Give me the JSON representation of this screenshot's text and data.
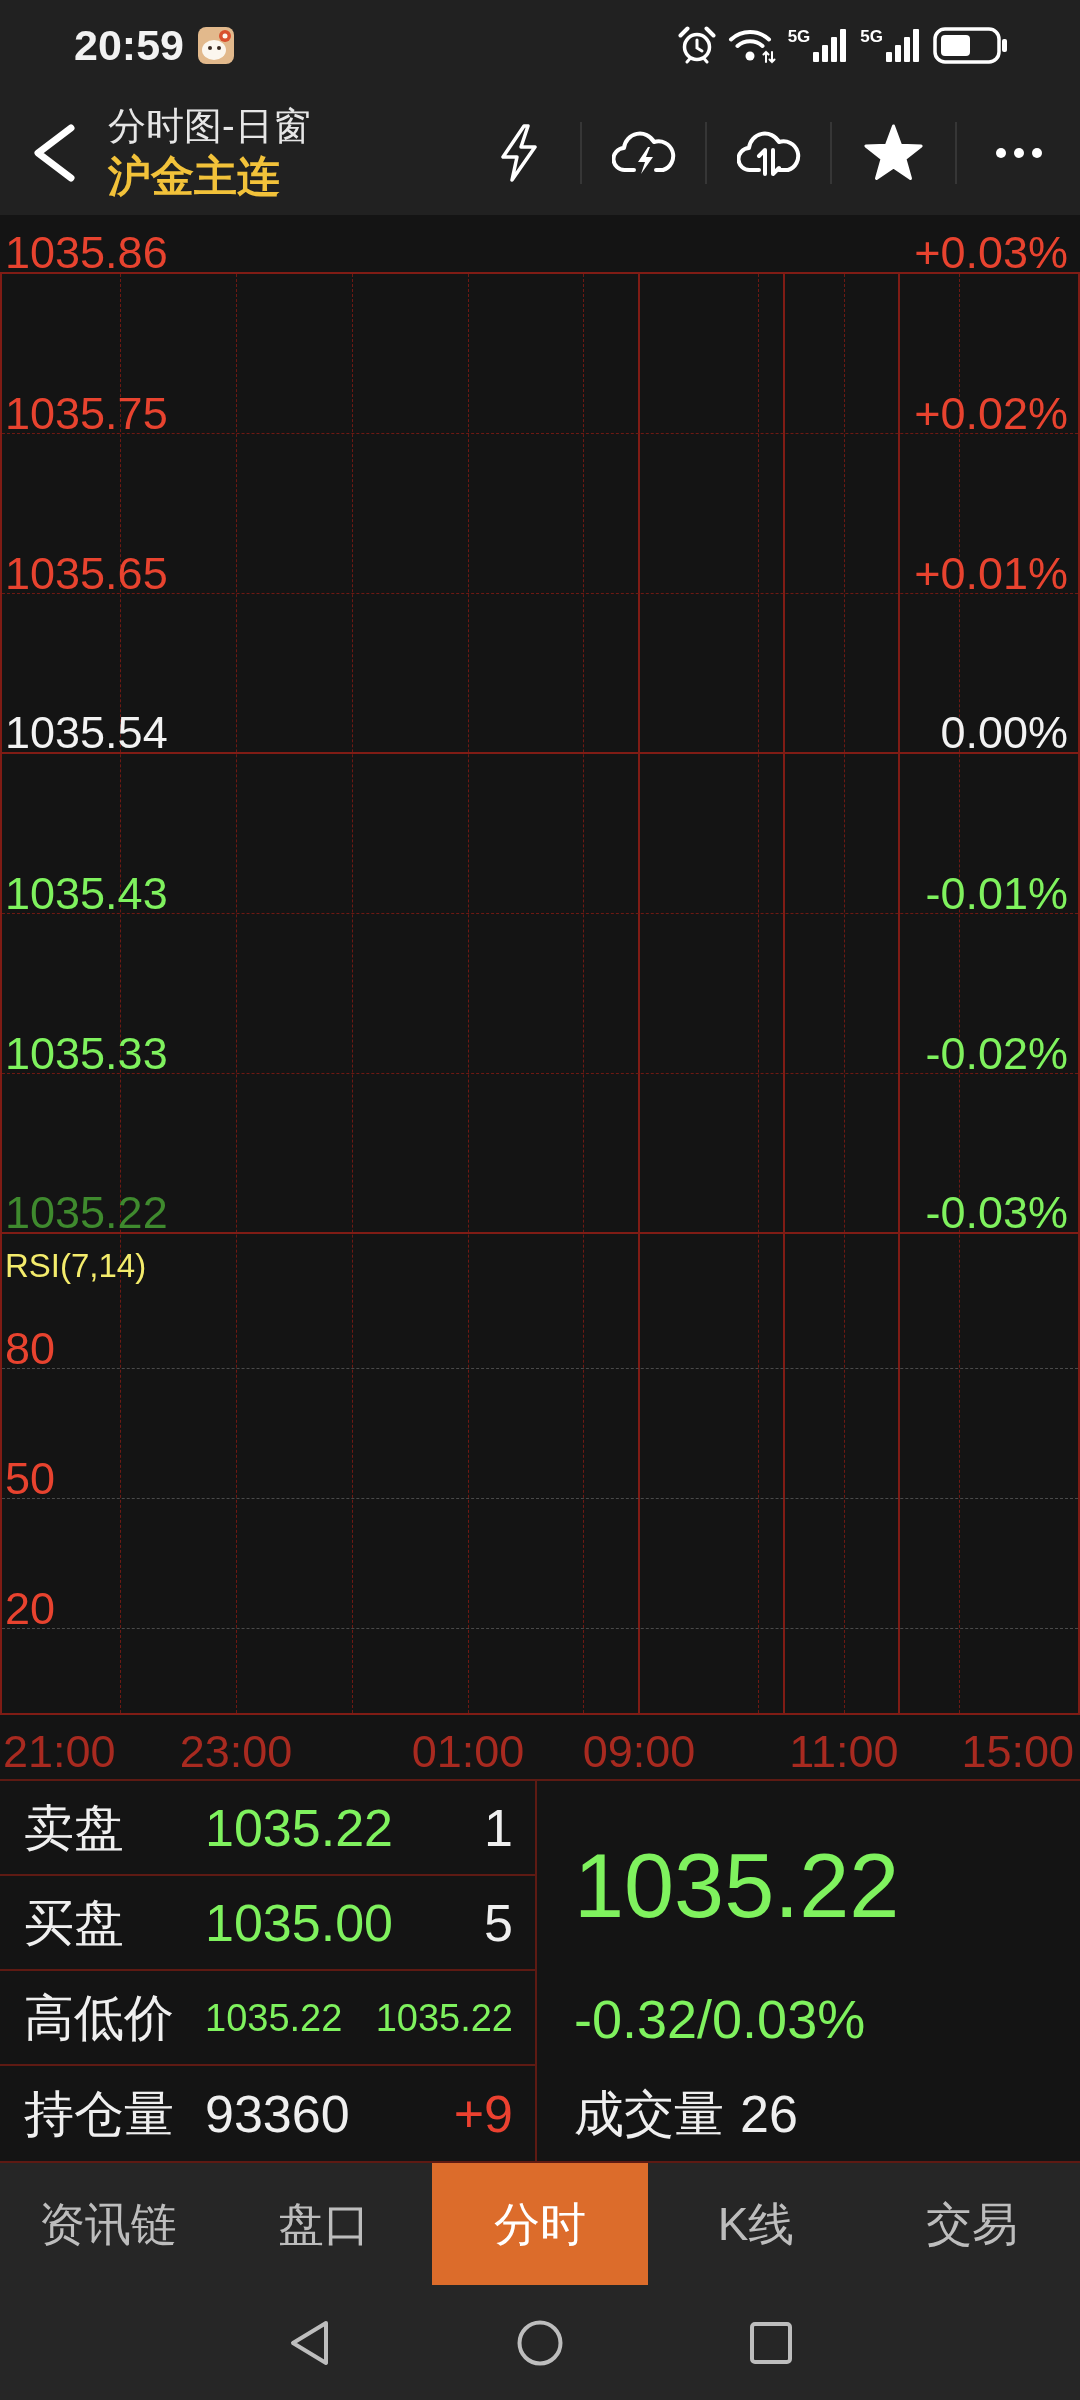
{
  "status_bar": {
    "time": "20:59",
    "networks": [
      {
        "label": "5G"
      },
      {
        "label": "5G"
      }
    ]
  },
  "header": {
    "title": "分时图-日窗",
    "subtitle": "沪金主连"
  },
  "price_chart": {
    "price_labels": [
      {
        "text": "1035.86",
        "color": "#e8432f"
      },
      {
        "text": "1035.75",
        "color": "#e8432f"
      },
      {
        "text": "1035.65",
        "color": "#e8432f"
      },
      {
        "text": "1035.54",
        "color": "#f2f2f2"
      },
      {
        "text": "1035.43",
        "color": "#7ff25e"
      },
      {
        "text": "1035.33",
        "color": "#7ff25e"
      },
      {
        "text": "1035.22",
        "color": "#3f8a2e"
      }
    ],
    "percent_labels": [
      {
        "text": "+0.03%",
        "color": "#e8432f"
      },
      {
        "text": "+0.02%",
        "color": "#e8432f"
      },
      {
        "text": "+0.01%",
        "color": "#e8432f"
      },
      {
        "text": "0.00%",
        "color": "#f2f2f2"
      },
      {
        "text": "-0.01%",
        "color": "#7ff25e"
      },
      {
        "text": "-0.02%",
        "color": "#7ff25e"
      },
      {
        "text": "-0.03%",
        "color": "#7ff25e"
      }
    ]
  },
  "indicator": {
    "label": "RSI(7,14)",
    "levels": [
      "80",
      "50",
      "20"
    ]
  },
  "time_axis": [
    "21:00",
    "23:00",
    "01:00",
    "09:00",
    "11:00",
    "15:00"
  ],
  "quote_panel": {
    "rows": [
      {
        "kind": "order",
        "label": "卖盘",
        "price": "1035.22",
        "volume": "1"
      },
      {
        "kind": "order",
        "label": "买盘",
        "price": "1035.00",
        "volume": "5"
      },
      {
        "kind": "range",
        "label": "高低价",
        "high": "1035.22",
        "low": "1035.22"
      },
      {
        "kind": "position",
        "label": "持仓量",
        "value": "93360",
        "change": "+9"
      }
    ],
    "last_price": "1035.22",
    "change": "-0.32/0.03%",
    "volume": {
      "label": "成交量",
      "value": "26"
    }
  },
  "tabs": [
    {
      "label": "资讯链",
      "selected": false
    },
    {
      "label": "盘口",
      "selected": false
    },
    {
      "label": "分时",
      "selected": true
    },
    {
      "label": "K线",
      "selected": false
    },
    {
      "label": "交易",
      "selected": false
    }
  ]
}
